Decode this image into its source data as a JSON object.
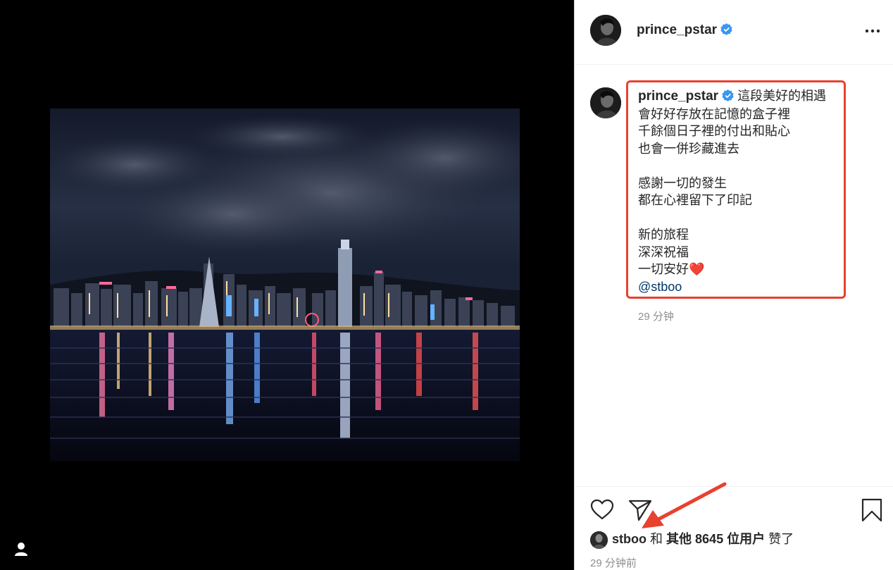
{
  "post": {
    "username": "prince_pstar",
    "caption_username": "prince_pstar",
    "caption_lines": [
      "這段美好的相遇",
      "會好好存放在記憶的盒子裡",
      "千餘個日子裡的付出和貼心",
      "也會一併珍藏進去",
      "",
      "感謝一切的發生",
      "都在心裡留下了印記",
      "",
      "新的旅程",
      "深深祝福",
      "一切安好"
    ],
    "heart_emoji": "❤️",
    "mention": "@stboo",
    "caption_time": "29 分钟",
    "post_time": "29 分钟前"
  },
  "likes": {
    "first_user": "stboo",
    "connector": "和",
    "others": "其他 8645 位用户",
    "suffix": "赞了"
  },
  "icons": {
    "verified": "verified-badge-icon",
    "more": "more-options-icon",
    "like": "heart-icon",
    "share": "paper-plane-icon",
    "save": "bookmark-icon",
    "profile": "user-icon"
  },
  "colors": {
    "verified_blue": "#3897f0",
    "highlight_red": "#e8412f",
    "mention_blue": "#00376b",
    "meta_gray": "#8e8e8e"
  }
}
